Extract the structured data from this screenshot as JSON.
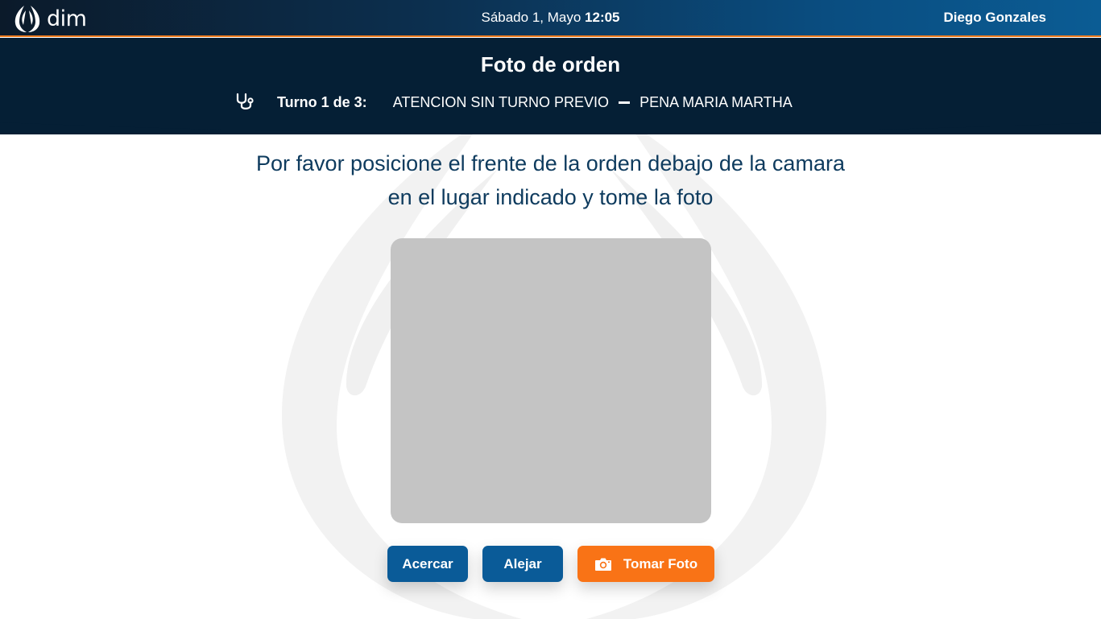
{
  "app": {
    "logo_text": "dim",
    "date_label": "Sábado 1, Mayo",
    "time": "12:05",
    "user_name": "Diego Gonzales"
  },
  "header": {
    "title": "Foto de orden",
    "turn_label": "Turno 1 de 3:",
    "turn_type": "ATENCION SIN TURNO PREVIO",
    "patient_name": "PENA MARIA MARTHA"
  },
  "main": {
    "instruction_line1": "Por favor posicione el frente de la orden debajo de la camara",
    "instruction_line2": "en el lugar indicado y tome la foto"
  },
  "buttons": {
    "zoom_in": "Acercar",
    "zoom_out": "Alejar",
    "take_photo": "Tomar Foto"
  },
  "icons": {
    "logo": "flame-logo-icon",
    "turn": "stethoscope-icon",
    "photo": "camera-icon"
  },
  "colors": {
    "header_bg": "#051f35",
    "accent_orange": "#f97316",
    "button_blue": "#0a5b98",
    "instruction_text": "#0e3b5e",
    "camera_placeholder": "#c4c4c4"
  }
}
